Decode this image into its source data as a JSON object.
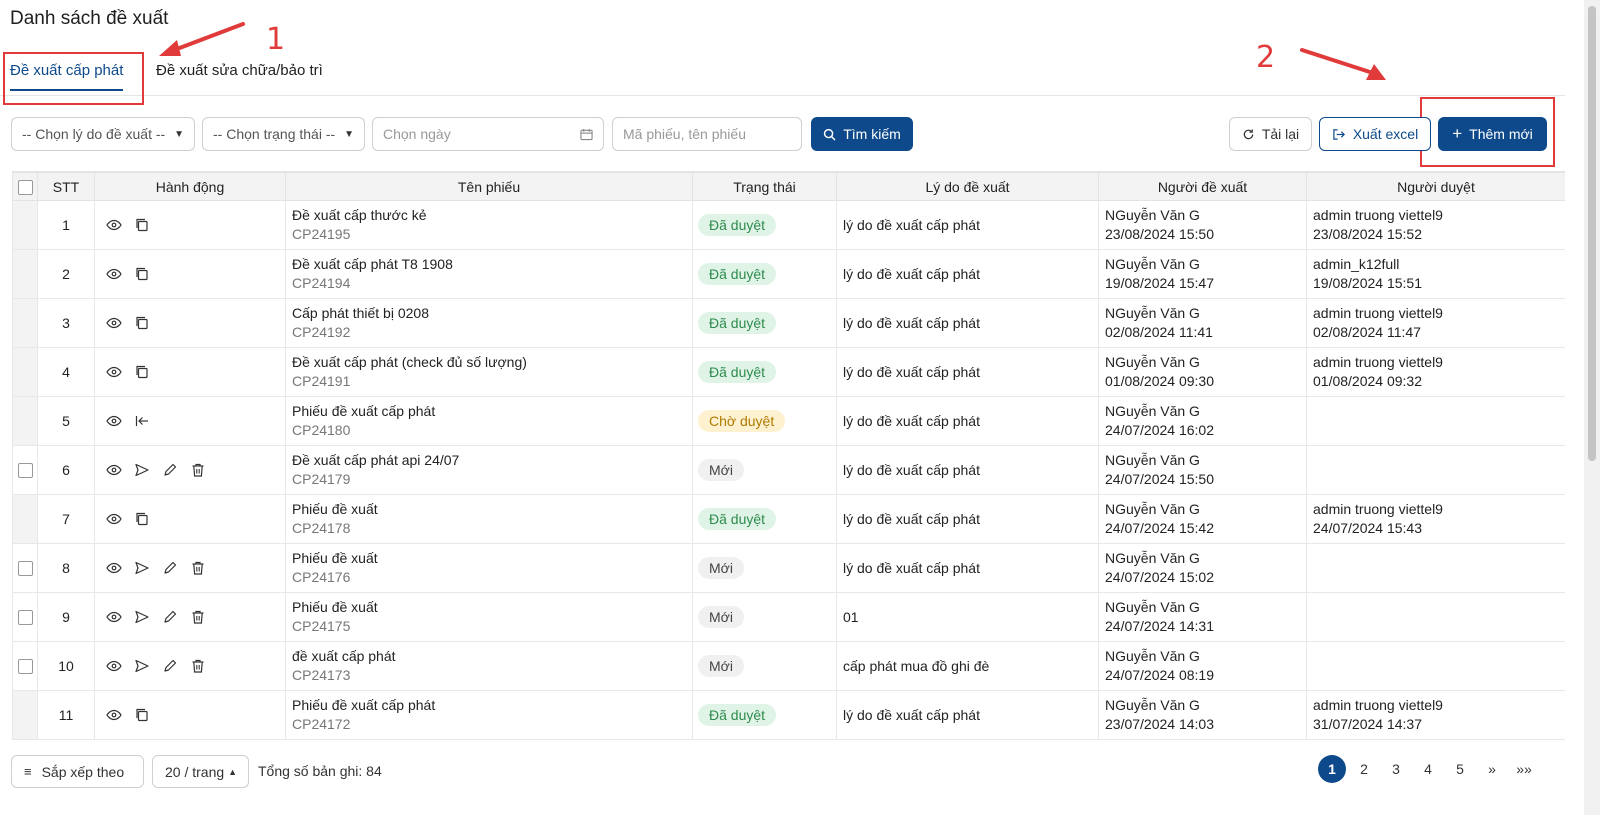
{
  "page_title": "Danh sách đề xuất",
  "tabs": [
    {
      "label": "Đề xuất cấp phát",
      "active": true
    },
    {
      "label": "Đề xuất sửa chữa/bảo trì",
      "active": false
    }
  ],
  "annotations": {
    "one": "1",
    "two": "2",
    "color": "#e03a3a"
  },
  "filters": {
    "reason_select": "-- Chọn lý do đề xuất --",
    "status_select": "-- Chọn trạng thái --",
    "date_placeholder": "Chọn ngày",
    "code_placeholder": "Mã phiếu, tên phiếu"
  },
  "buttons": {
    "search": "Tìm kiếm",
    "reload": "Tải lại",
    "export": "Xuất excel",
    "add": "Thêm mới"
  },
  "table": {
    "headers": [
      "STT",
      "Hành động",
      "Tên phiếu",
      "Trạng thái",
      "Lý do đề xuất",
      "Người đề xuất",
      "Người duyệt"
    ],
    "rows": [
      {
        "stt": "1",
        "name": "Đề xuất cấp thước kẻ",
        "code": "CP24195",
        "status": "Đã duyệt",
        "reason": "lý do đề xuất cấp phát",
        "proposer": "NGuyễn Văn G",
        "proposer_time": "23/08/2024 15:50",
        "approver": "admin truong viettel9",
        "approver_time": "23/08/2024 15:52"
      },
      {
        "stt": "2",
        "name": "Đề xuất cấp phát T8 1908",
        "code": "CP24194",
        "status": "Đã duyệt",
        "reason": "lý do đề xuất cấp phát",
        "proposer": "NGuyễn Văn G",
        "proposer_time": "19/08/2024 15:47",
        "approver": "admin_k12full",
        "approver_time": "19/08/2024 15:51"
      },
      {
        "stt": "3",
        "name": "Cấp phát thiết bị 0208",
        "code": "CP24192",
        "status": "Đã duyệt",
        "reason": "lý do đề xuất cấp phát",
        "proposer": "NGuyễn Văn G",
        "proposer_time": "02/08/2024 11:41",
        "approver": "admin truong viettel9",
        "approver_time": "02/08/2024 11:47"
      },
      {
        "stt": "4",
        "name": "Đề xuất cấp phát (check đủ số lượng)",
        "code": "CP24191",
        "status": "Đã duyệt",
        "reason": "lý do đề xuất cấp phát",
        "proposer": "NGuyễn Văn G",
        "proposer_time": "01/08/2024 09:30",
        "approver": "admin truong viettel9",
        "approver_time": "01/08/2024 09:32"
      },
      {
        "stt": "5",
        "name": "Phiếu đề xuất cấp phát",
        "code": "CP24180",
        "status": "Chờ duyệt",
        "reason": "lý do đề xuất cấp phát",
        "proposer": "NGuyễn Văn G",
        "proposer_time": "24/07/2024 16:02",
        "approver": "",
        "approver_time": ""
      },
      {
        "stt": "6",
        "name": "Đề xuất cấp phát api 24/07",
        "code": "CP24179",
        "status": "Mới",
        "reason": "lý do đề xuất cấp phát",
        "proposer": "NGuyễn Văn G",
        "proposer_time": "24/07/2024 15:50",
        "approver": "",
        "approver_time": ""
      },
      {
        "stt": "7",
        "name": "Phiếu đề xuất",
        "code": "CP24178",
        "status": "Đã duyệt",
        "reason": "lý do đề xuất cấp phát",
        "proposer": "NGuyễn Văn G",
        "proposer_time": "24/07/2024 15:42",
        "approver": "admin truong viettel9",
        "approver_time": "24/07/2024 15:43"
      },
      {
        "stt": "8",
        "name": "Phiếu đề xuất",
        "code": "CP24176",
        "status": "Mới",
        "reason": "lý do đề xuất cấp phát",
        "proposer": "NGuyễn Văn G",
        "proposer_time": "24/07/2024 15:02",
        "approver": "",
        "approver_time": ""
      },
      {
        "stt": "9",
        "name": "Phiếu đề xuất",
        "code": "CP24175",
        "status": "Mới",
        "reason": "01",
        "proposer": "NGuyễn Văn G",
        "proposer_time": "24/07/2024 14:31",
        "approver": "",
        "approver_time": ""
      },
      {
        "stt": "10",
        "name": "đề xuất cấp phát",
        "code": "CP24173",
        "status": "Mới",
        "reason": "cấp phát mua đồ ghi đè",
        "proposer": "NGuyễn Văn G",
        "proposer_time": "24/07/2024 08:19",
        "approver": "",
        "approver_time": ""
      },
      {
        "stt": "11",
        "name": "Phiếu đề xuất cấp phát",
        "code": "CP24172",
        "status": "Đã duyệt",
        "reason": "lý do đề xuất cấp phát",
        "proposer": "NGuyễn Văn G",
        "proposer_time": "23/07/2024 14:03",
        "approver": "admin truong viettel9",
        "approver_time": "31/07/2024 14:37"
      }
    ]
  },
  "footer": {
    "sort_label": "Sắp xếp theo",
    "page_size": "20 / trang",
    "total": "Tổng số bản ghi: 84",
    "pages": [
      "1",
      "2",
      "3",
      "4",
      "5"
    ],
    "current_page": "1",
    "next": "»",
    "last": "»»"
  },
  "colors": {
    "primary": "#0e4a8b",
    "approved_bg": "#dff4e6",
    "pending_bg": "#fdf1d0",
    "new_bg": "#f0f0f0"
  }
}
